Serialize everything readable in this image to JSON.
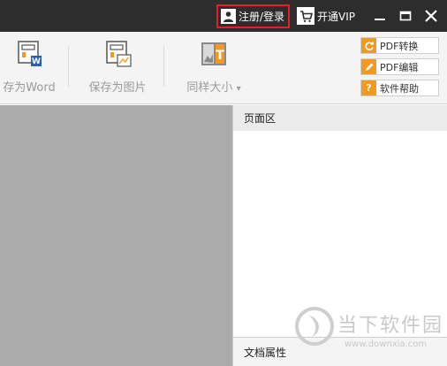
{
  "titlebar": {
    "login_label": "注册/登录",
    "vip_label": "开通VIP",
    "login_highlight_color": "#e81e24",
    "icons": [
      "user-icon",
      "cart-icon",
      "minimize-icon",
      "maximize-icon",
      "close-icon"
    ]
  },
  "toolbar": {
    "save_word_label": "存为Word",
    "save_image_label": "保存为图片",
    "same_size_label": "同样大小",
    "same_size_caret": "▾"
  },
  "side_buttons": [
    {
      "label": "PDF转换",
      "icon": "refresh-icon",
      "color": "#f39a1e"
    },
    {
      "label": "PDF编辑",
      "icon": "pencil-icon",
      "color": "#f39a1e"
    },
    {
      "label": "软件帮助",
      "icon": "help-icon",
      "color": "#f39a1e",
      "glyph": "?"
    }
  ],
  "panel": {
    "pages_title": "页面区",
    "properties_title": "文档属性"
  },
  "watermark": {
    "title": "当下软件园",
    "url": "www.downxia.com"
  }
}
